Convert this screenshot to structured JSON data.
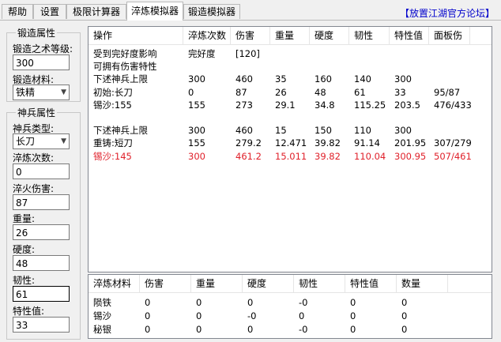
{
  "tabs": [
    {
      "label": "帮助"
    },
    {
      "label": "设置"
    },
    {
      "label": "极限计算器"
    },
    {
      "label": "淬炼模拟器"
    },
    {
      "label": "锻造模拟器"
    }
  ],
  "forum_link": "【放置江湖官方论坛】",
  "forge_group": {
    "title": "锻造属性",
    "level_label": "锻造之术等级:",
    "level_value": "300",
    "material_label": "锻造材料:",
    "material_value": "铁精"
  },
  "weapon_group": {
    "title": "神兵属性",
    "type_label": "神兵类型:",
    "type_value": "长刀",
    "count_label": "淬炼次数:",
    "count_value": "0",
    "damage_label": "淬火伤害:",
    "damage_value": "87",
    "weight_label": "重量:",
    "weight_value": "26",
    "hardness_label": "硬度:",
    "hardness_value": "48",
    "toughness_label": "韧性:",
    "toughness_value": "61",
    "trait_label": "特性值:",
    "trait_value": "33"
  },
  "main_table": {
    "headers": [
      "操作",
      "淬炼次数",
      "伤害",
      "重量",
      "硬度",
      "韧性",
      "特性值",
      "面板伤"
    ],
    "rows": [
      {
        "cells": [
          "受到完好度影响",
          "完好度",
          "[120]",
          "",
          "",
          "",
          "",
          ""
        ],
        "red": false
      },
      {
        "cells": [
          "可拥有伤害特性",
          "",
          "",
          "",
          "",
          "",
          "",
          ""
        ],
        "red": false
      },
      {
        "cells": [
          "下述神兵上限",
          "300",
          "460",
          "35",
          "160",
          "140",
          "300",
          ""
        ],
        "red": false
      },
      {
        "cells": [
          "初始:长刀",
          "0",
          "87",
          "26",
          "48",
          "61",
          "33",
          "95/87"
        ],
        "red": false
      },
      {
        "cells": [
          "锡沙:155",
          "155",
          "273",
          "29.1",
          "34.8",
          "115.25",
          "203.5",
          "476/433"
        ],
        "red": false
      },
      {
        "cells": [
          "",
          "",
          "",
          "",
          "",
          "",
          "",
          ""
        ],
        "red": false
      },
      {
        "cells": [
          "下述神兵上限",
          "300",
          "460",
          "15",
          "150",
          "110",
          "300",
          ""
        ],
        "red": false
      },
      {
        "cells": [
          "重铸:短刀",
          "155",
          "279.2",
          "12.471",
          "39.82",
          "91.14",
          "201.95",
          "307/279"
        ],
        "red": false
      },
      {
        "cells": [
          "锡沙:145",
          "300",
          "461.2",
          "15.011",
          "39.82",
          "110.04",
          "300.95",
          "507/461"
        ],
        "red": true
      }
    ]
  },
  "material_table": {
    "headers": [
      "淬炼材料",
      "伤害",
      "重量",
      "硬度",
      "韧性",
      "特性值",
      "数量"
    ],
    "rows": [
      [
        "陨铁",
        "0",
        "0",
        "0",
        "-0",
        "0",
        "0"
      ],
      [
        "锡沙",
        "0",
        "0",
        "-0",
        "0",
        "0",
        "0"
      ],
      [
        "秘银",
        "0",
        "0",
        "0",
        "-0",
        "0",
        "0"
      ]
    ]
  },
  "colors": {
    "highlight_red": "#e0202a",
    "link_blue": "#0000cc"
  },
  "icons": {
    "dropdown": "chevron-down-icon"
  }
}
